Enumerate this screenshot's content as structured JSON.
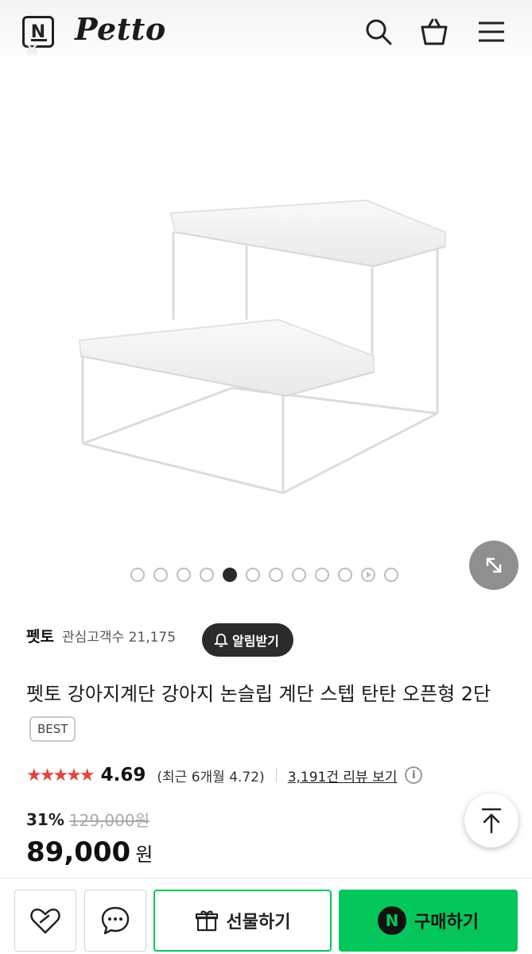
{
  "header": {
    "logo_letter": "N",
    "close_glyph": "✕",
    "brand": "Petto",
    "icons": [
      "search-icon",
      "cart-icon",
      "menu-icon"
    ]
  },
  "gallery": {
    "total_items": 12,
    "active_index": 4,
    "video_index": 10
  },
  "store": {
    "name": "펫토",
    "fans_label": "관심고객수 21,175",
    "alert_label": "알림받기"
  },
  "product": {
    "title": "펫토 강아지계단 강아지 논슬립 계단 스텝 탄탄 오픈형 2단",
    "badge": "BEST"
  },
  "rating": {
    "stars": "★★★★★",
    "score": "4.69",
    "recent": "(최근 6개월 4.72)",
    "reviews": "3,191건 리뷰 보기",
    "info": "i"
  },
  "price": {
    "discount": "31%",
    "original": "129,000원",
    "sale": "89,000",
    "unit": "원"
  },
  "bottom_bar": {
    "gift_label": "선물하기",
    "buy_label": "구매하기",
    "npay_letter": "N"
  },
  "colors": {
    "accent_green": "#03c75a",
    "star_red": "#e0463d"
  }
}
